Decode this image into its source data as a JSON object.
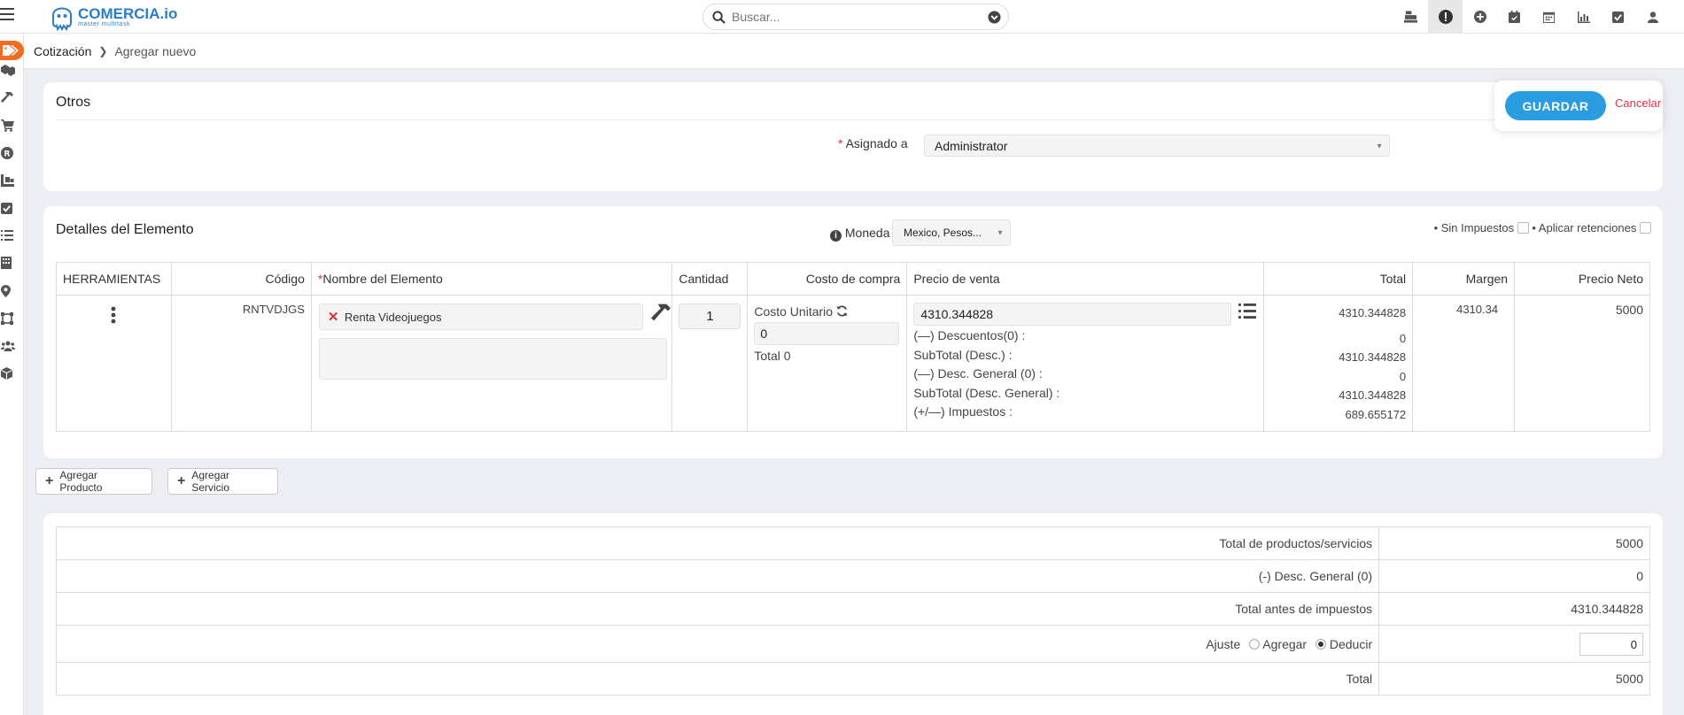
{
  "app": {
    "logo_name": "COMERCIA.io",
    "logo_tagline": "master multitask"
  },
  "search": {
    "placeholder": "Buscar..."
  },
  "topbar_icons": [
    "cash-register-icon",
    "alert-icon",
    "add-circle-icon",
    "calendar-check-icon",
    "calendar-icon",
    "chart-icon",
    "checkbox-icon",
    "user-icon"
  ],
  "sidebar_icons": [
    "tag-icon",
    "boxes-icon",
    "hammer-icon",
    "cart-icon",
    "registered-icon",
    "pallet-icon",
    "checkbox-icon",
    "list-icon",
    "building-icon",
    "map-pin-icon",
    "workflow-icon",
    "users-icon",
    "cube-icon"
  ],
  "breadcrumb": {
    "parent": "Cotización",
    "current": "Agregar nuevo"
  },
  "actions": {
    "save_label": "GUARDAR",
    "cancel_label": "Cancelar"
  },
  "otros": {
    "title": "Otros",
    "assigned_label": "Asignado a",
    "assigned_value": "Administrator"
  },
  "detalles": {
    "title": "Detalles del Elemento",
    "currency_label": "Moneda",
    "currency_value": "Mexico, Pesos...",
    "sin_impuestos_label": "• Sin Impuestos",
    "aplicar_retenciones_label": "• Aplicar retenciones",
    "columns": {
      "tools": "HERRAMIENTAS",
      "code": "Código",
      "name": "Nombre del Elemento",
      "qty": "Cantidad",
      "cost": "Costo de compra",
      "price": "Precio de venta",
      "total": "Total",
      "margin": "Margen",
      "net": "Precio Neto"
    },
    "row": {
      "code": "RNTVDJGS",
      "name": "Renta Videojuegos",
      "qty": "1",
      "cost_label": "Costo Unitario",
      "cost_value": "0",
      "cost_total": "Total 0",
      "price_value": "4310.344828",
      "discounts_label": "(—) Descuentos(0) :",
      "subtotal_desc_label": "SubTotal (Desc.) :",
      "general_desc_label": "(—) Desc. General (0) :",
      "subtotal_general_label": "SubTotal (Desc. General) :",
      "taxes_label": "(+/—) Impuestos :",
      "total_main": "4310.344828",
      "total_discounts": "0",
      "total_subtotal_desc": "4310.344828",
      "total_general_desc": "0",
      "total_subtotal_general": "4310.344828",
      "total_taxes": "689.655172",
      "margin": "4310.34",
      "net": "5000"
    }
  },
  "add_buttons": {
    "product": "Agregar Producto",
    "service": "Agregar Servicio"
  },
  "totals": {
    "products_label": "Total de productos/servicios",
    "products_value": "5000",
    "general_desc_label": "(-) Desc. General (0)",
    "general_desc_value": "0",
    "before_tax_label": "Total antes de impuestos",
    "before_tax_value": "4310.344828",
    "adjust_label": "Ajuste",
    "adjust_add_label": "Agregar",
    "adjust_deduct_label": "Deducir",
    "adjust_value": "0",
    "total_label": "Total",
    "total_value": "5000"
  }
}
